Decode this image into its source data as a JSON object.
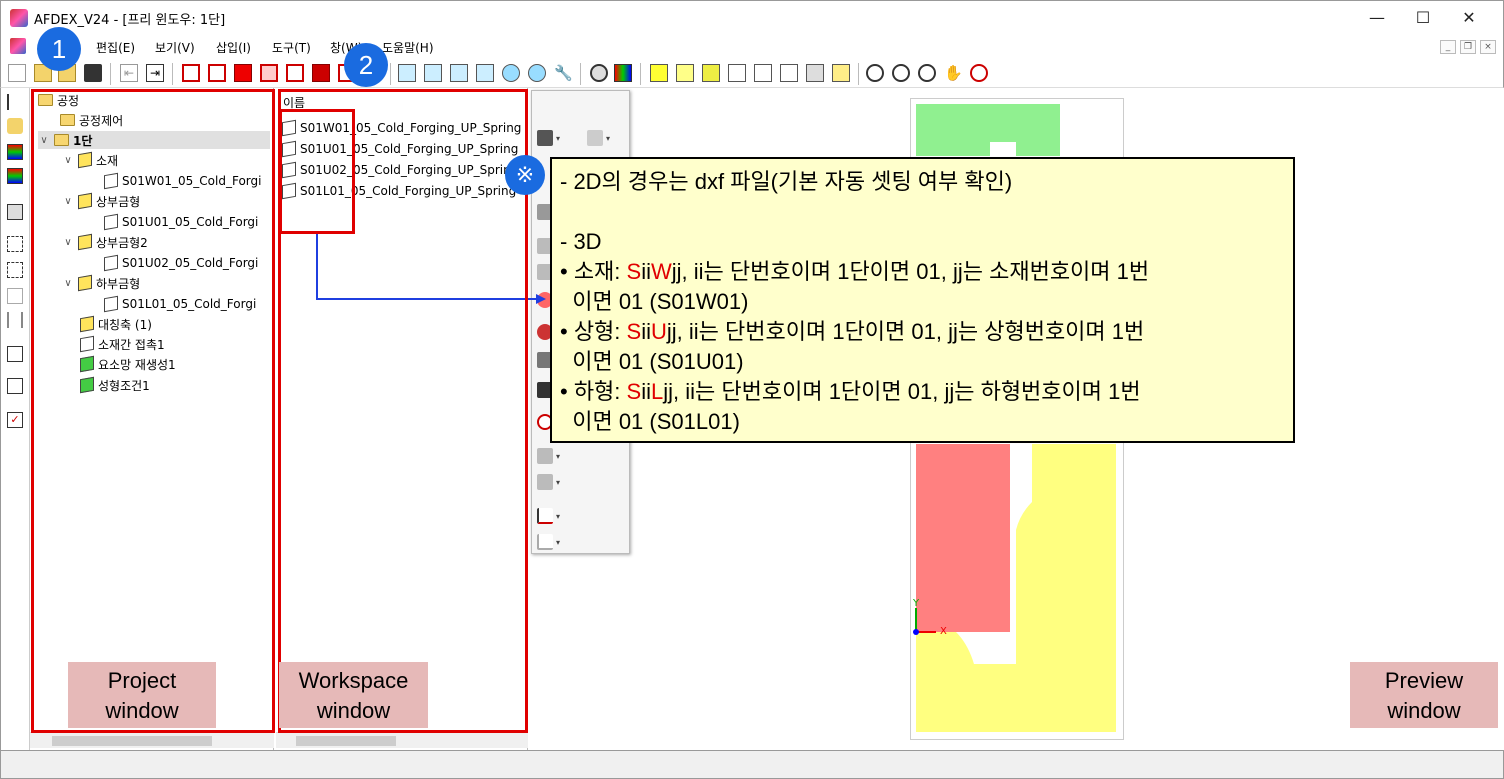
{
  "window": {
    "title": "AFDEX_V24 - [프리 윈도우: 1단]",
    "minimize": "—",
    "maximize": "☐",
    "close": "✕"
  },
  "menu": {
    "items": [
      "편집(E)",
      "보기(V)",
      "삽입(I)",
      "도구(T)",
      "창(W)",
      "도움말(H)"
    ]
  },
  "project": {
    "root": "공정",
    "items": {
      "process_control": "공정제어",
      "stage": "1단",
      "material": "소재",
      "material_file": "S01W01_05_Cold_Forgi",
      "upper_die": "상부금형",
      "upper_die_file": "S01U01_05_Cold_Forgi",
      "upper_die2": "상부금형2",
      "upper_die2_file": "S01U02_05_Cold_Forgi",
      "lower_die": "하부금형",
      "lower_die_file": "S01L01_05_Cold_Forgi",
      "symmetry": "대칭축 (1)",
      "contact": "소재간 접촉1",
      "remesh": "요소망 재생성1",
      "forming_condition": "성형조건1"
    }
  },
  "workspace": {
    "header": "이름",
    "files": [
      "S01W01_05_Cold_Forging_UP_Spring",
      "S01U01_05_Cold_Forging_UP_Spring",
      "S01U02_05_Cold_Forging_UP_Spring",
      "S01L01_05_Cold_Forging_UP_Spring"
    ]
  },
  "annotations": {
    "badge1": "1",
    "badge2": "2",
    "note_marker": "※",
    "project_label": [
      "Project",
      "window"
    ],
    "workspace_label": [
      "Workspace",
      "window"
    ],
    "preview_label": [
      "Preview",
      "window"
    ]
  },
  "callout": {
    "line1": "- 2D의 경우는 dxf 파일(기본 자동 셋팅 여부 확인)",
    "line2": "- 3D",
    "m_prefix": "• 소재: ",
    "m_s": "S",
    "m_ii": "ii",
    "m_code": "W",
    "m_rest": "jj, ii는 단번호이며 1단이면 01, jj는 소재번호이며 1번",
    "m_line2": "  이면 01 (S01W01)",
    "u_prefix": "• 상형: ",
    "u_s": "S",
    "u_ii": "ii",
    "u_code": "U",
    "u_rest": "jj, ii는 단번호이며 1단이면 01, jj는 상형번호이며 1번",
    "u_line2": "  이면 01 (S01U01)",
    "l_prefix": "• 하형: ",
    "l_s": "S",
    "l_ii": "ii",
    "l_code": "L",
    "l_rest": "jj, ii는 단번호이며 1단이면 01, jj는 하형번호이며 1번",
    "l_line2": "  이면 01 (S01L01)"
  },
  "preview": {
    "axis_x": "X",
    "axis_y": "Y",
    "colors": {
      "material": "#90f090",
      "upper": "#ff8080",
      "lower": "#ffff80"
    }
  }
}
